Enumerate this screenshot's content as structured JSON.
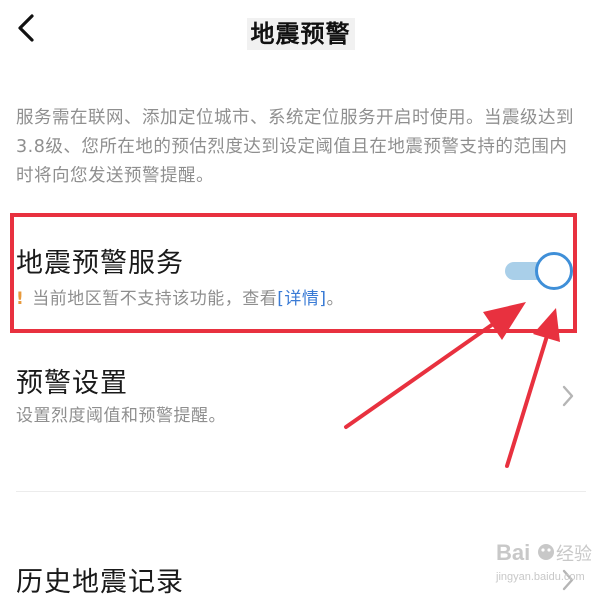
{
  "header": {
    "title": "地震预警",
    "back_icon": "back-arrow-icon"
  },
  "description": "服务需在联网、添加定位城市、系统定位服务开启时使用。当震级达到3.8级、您所在地的预估烈度达到设定阈值且在地震预警支持的范围内时将向您发送预警提醒。",
  "service": {
    "title": "地震预警服务",
    "warning_mark": "!",
    "notice": "当前地区暂不支持该功能，查看",
    "link": "[详情]",
    "notice_end": "。",
    "toggle_on": true
  },
  "settings": {
    "title": "预警设置",
    "subtitle": "设置烈度阈值和预警提醒。"
  },
  "history": {
    "title": "历史地震记录"
  },
  "watermark": {
    "brand": "Bai",
    "brand2": "经验",
    "url": "jingyan.baidu.com"
  },
  "colors": {
    "highlight": "#e8313f",
    "toggle": "#3f8fd8",
    "link": "#3a7bd5",
    "arrow": "#e8313f"
  }
}
